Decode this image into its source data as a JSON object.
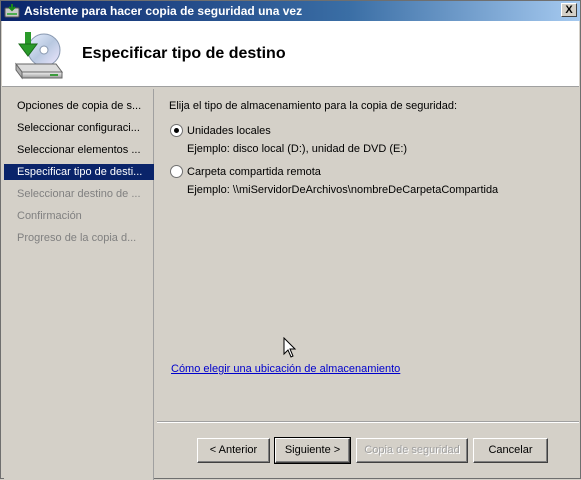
{
  "window": {
    "title": "Asistente para hacer copia de seguridad una vez",
    "close_label": "X"
  },
  "header": {
    "title": "Especificar tipo de destino"
  },
  "nav": {
    "items": [
      {
        "label": "Opciones de copia de s...",
        "state": "enabled"
      },
      {
        "label": "Seleccionar configuraci...",
        "state": "enabled"
      },
      {
        "label": "Seleccionar elementos ...",
        "state": "enabled"
      },
      {
        "label": "Especificar tipo de desti...",
        "state": "active"
      },
      {
        "label": "Seleccionar destino de ...",
        "state": "disabled"
      },
      {
        "label": "Confirmación",
        "state": "disabled"
      },
      {
        "label": "Progreso de la copia d...",
        "state": "disabled"
      }
    ]
  },
  "content": {
    "prompt": "Elija el tipo de almacenamiento para la copia de seguridad:",
    "options": [
      {
        "label": "Unidades locales",
        "example": "Ejemplo: disco local (D:), unidad de DVD (E:)",
        "checked": true
      },
      {
        "label": "Carpeta compartida remota",
        "example": "Ejemplo: \\\\miServidorDeArchivos\\nombreDeCarpetaCompartida",
        "checked": false
      }
    ],
    "help_link": "Cómo elegir una ubicación de almacenamiento"
  },
  "buttons": {
    "back": "< Anterior",
    "next": "Siguiente >",
    "backup": "Copia de seguridad",
    "cancel": "Cancelar"
  },
  "colors": {
    "titlebar_start": "#0a246a",
    "nav_active": "#0a246a",
    "link": "#0000cc"
  }
}
